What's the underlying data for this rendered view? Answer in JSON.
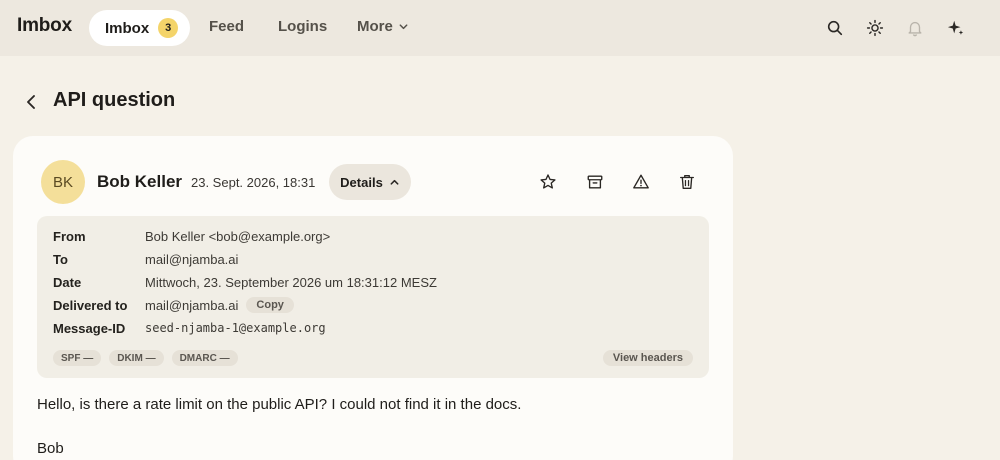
{
  "app": {
    "brand": "Imbox"
  },
  "nav": {
    "active_label": "Imbox",
    "unread_count": "3",
    "feed": "Feed",
    "logins": "Logins",
    "more": "More"
  },
  "icons": {
    "search": "search-icon",
    "theme": "sun-icon",
    "notifications": "bell-icon",
    "assistant": "sparkle-icon"
  },
  "page": {
    "title": "API question"
  },
  "message": {
    "initials": "BK",
    "sender": "Bob Keller",
    "date": "23. Sept. 2026, 18:31",
    "details_label": "Details",
    "headers": {
      "from_key": "From",
      "from_val": "Bob Keller <bob@example.org>",
      "to_key": "To",
      "to_val": "mail@njamba.ai",
      "date_key": "Date",
      "date_val": "Mittwoch, 23. September 2026 um 18:31:12 MESZ",
      "delivered_key": "Delivered to",
      "delivered_val": "mail@njamba.ai",
      "copy": "Copy",
      "msgid_key": "Message-ID",
      "msgid_val": "seed-njamba-1@example.org"
    },
    "auth": {
      "spf": "SPF —",
      "dkim": "DKIM —",
      "dmarc": "DMARC —"
    },
    "view_headers": "View headers",
    "body": "Hello, is there a rate limit on the public API? I could not find it in the docs.",
    "signature": "Bob"
  },
  "colors": {
    "background": "#f5f1e8",
    "topbar": "#ede8df",
    "badge": "#f4d46a",
    "avatar": "#f4df9a"
  }
}
